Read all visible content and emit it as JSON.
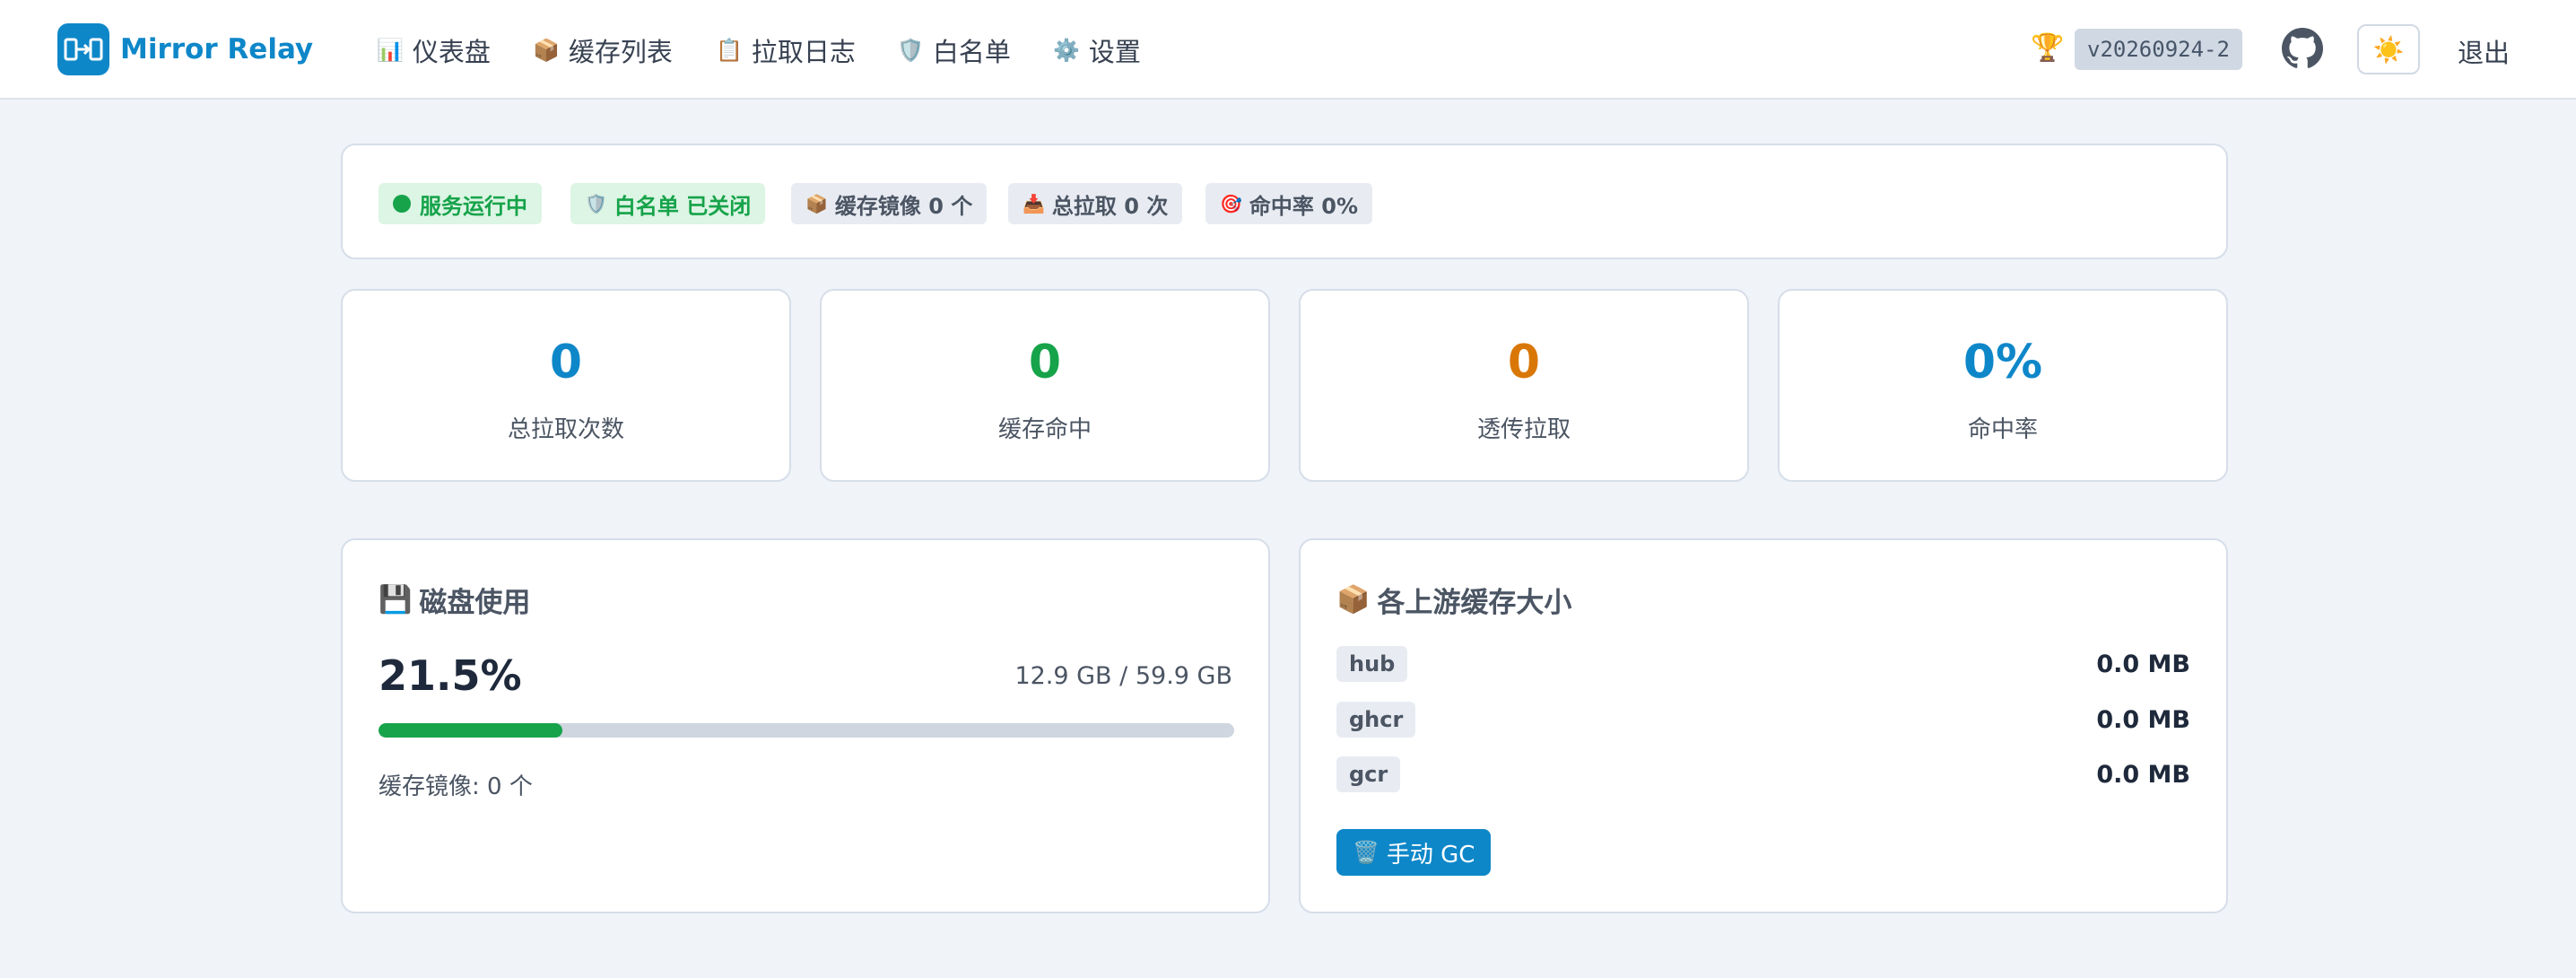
{
  "header": {
    "app_name": "Mirror Relay",
    "nav": [
      {
        "icon": "chart-icon",
        "glyph": "📊",
        "label": "仪表盘"
      },
      {
        "icon": "package-icon",
        "glyph": "📦",
        "label": "缓存列表"
      },
      {
        "icon": "clipboard-icon",
        "glyph": "📋",
        "label": "拉取日志"
      },
      {
        "icon": "shield-icon",
        "glyph": "🛡️",
        "label": "白名单"
      },
      {
        "icon": "gear-icon",
        "glyph": "⚙️",
        "label": "设置"
      }
    ],
    "trophy_glyph": "🏆",
    "version": "v20260924-2",
    "theme_glyph": "☀️",
    "logout": "退出"
  },
  "status": {
    "running": "服务运行中",
    "whitelist": "白名单 已关闭",
    "cached_images": "缓存镜像 0 个",
    "total_pulls": "总拉取 0 次",
    "hit_rate": "命中率 0%"
  },
  "stats": [
    {
      "value": "0",
      "label": "总拉取次数",
      "color": "#0e87c9"
    },
    {
      "value": "0",
      "label": "缓存命中",
      "color": "#16a34a"
    },
    {
      "value": "0",
      "label": "透传拉取",
      "color": "#d97706"
    },
    {
      "value": "0%",
      "label": "命中率",
      "color": "#0e87c9"
    }
  ],
  "disk": {
    "title": "磁盘使用",
    "percent_label": "21.5%",
    "percent": 21.5,
    "size": "12.9 GB / 59.9 GB",
    "cached_images": "缓存镜像: 0 个"
  },
  "upstream": {
    "title": "各上游缓存大小",
    "items": [
      {
        "name": "hub",
        "size": "0.0 MB"
      },
      {
        "name": "ghcr",
        "size": "0.0 MB"
      },
      {
        "name": "gcr",
        "size": "0.0 MB"
      }
    ],
    "gc_button": "手动 GC"
  },
  "colors": {
    "accent": "#0e87c9",
    "success": "#16a34a",
    "warning": "#d97706"
  }
}
